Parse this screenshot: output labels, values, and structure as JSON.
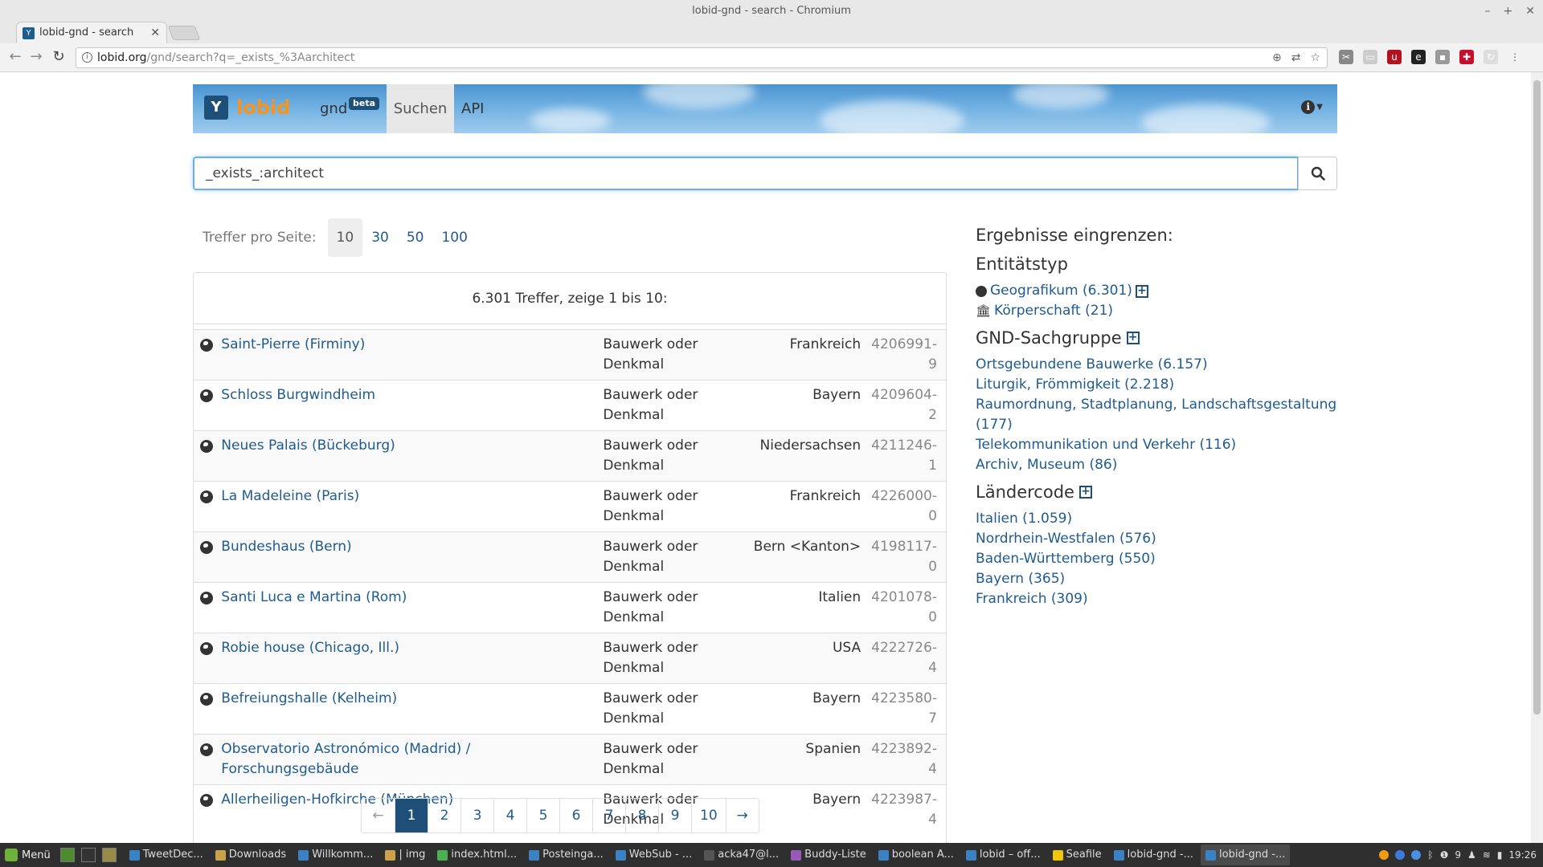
{
  "window": {
    "title": "lobid-gnd - search - Chromium",
    "tab_title": "lobid-gnd - search",
    "url_host": "lobid.org",
    "url_path": "/gnd/search?q=_exists_%3Aarchitect"
  },
  "header": {
    "brand": "lobid",
    "gnd": "gnd",
    "beta": "beta",
    "suchen": "Suchen",
    "api": "API"
  },
  "search": {
    "value": "_exists_:architect"
  },
  "perpage": {
    "label": "Treffer pro Seite:",
    "options": [
      "10",
      "30",
      "50",
      "100"
    ],
    "selected": "10"
  },
  "results": {
    "summary": "6.301 Treffer, zeige 1 bis 10:",
    "rows": [
      {
        "name": "Saint-Pierre (Firminy)",
        "type": "Bauwerk oder Denkmal",
        "country": "Frankreich",
        "id": "4206991-9"
      },
      {
        "name": "Schloss Burgwindheim",
        "type": "Bauwerk oder Denkmal",
        "country": "Bayern",
        "id": "4209604-2"
      },
      {
        "name": "Neues Palais (Bückeburg)",
        "type": "Bauwerk oder Denkmal",
        "country": "Niedersachsen",
        "id": "4211246-1"
      },
      {
        "name": "La Madeleine (Paris)",
        "type": "Bauwerk oder Denkmal",
        "country": "Frankreich",
        "id": "4226000-0"
      },
      {
        "name": "Bundeshaus (Bern)",
        "type": "Bauwerk oder Denkmal",
        "country": "Bern <Kanton>",
        "id": "4198117-0"
      },
      {
        "name": "Santi Luca e Martina (Rom)",
        "type": "Bauwerk oder Denkmal",
        "country": "Italien",
        "id": "4201078-0"
      },
      {
        "name": "Robie house (Chicago, Ill.)",
        "type": "Bauwerk oder Denkmal",
        "country": "USA",
        "id": "4222726-4"
      },
      {
        "name": "Befreiungshalle (Kelheim)",
        "type": "Bauwerk oder Denkmal",
        "country": "Bayern",
        "id": "4223580-7"
      },
      {
        "name": "Observatorio Astronómico (Madrid) / Forschungsgebäude",
        "type": "Bauwerk oder Denkmal",
        "country": "Spanien",
        "id": "4223892-4"
      },
      {
        "name": "Allerheiligen-Hofkirche (München)",
        "type": "Bauwerk oder Denkmal",
        "country": "Bayern",
        "id": "4223987-4"
      }
    ]
  },
  "pagination": {
    "prev": "←",
    "pages": [
      "1",
      "2",
      "3",
      "4",
      "5",
      "6",
      "7",
      "8",
      "9",
      "10"
    ],
    "current": "1",
    "next": "→"
  },
  "facets": {
    "title": "Ergebnisse eingrenzen:",
    "entity_heading": "Entitätstyp",
    "entity_items": [
      "Geografikum (6.301)",
      "Körperschaft (21)"
    ],
    "sachgruppe_heading": "GND-Sachgruppe",
    "sachgruppe_items": [
      "Ortsgebundene Bauwerke (6.157)",
      "Liturgik, Frömmigkeit (2.218)",
      "Raumordnung, Stadtplanung, Landschaftsgestaltung (177)",
      "Telekommunikation und Verkehr (116)",
      "Archiv, Museum (86)"
    ],
    "laendercode_heading": "Ländercode",
    "laendercode_items": [
      "Italien (1.059)",
      "Nordrhein-Westfalen (576)",
      "Baden-Württemberg (550)",
      "Bayern (365)",
      "Frankreich (309)"
    ]
  },
  "taskbar": {
    "menu": "Menü",
    "tasks": [
      "TweetDec...",
      "Downloads",
      "Willkomm...",
      "| img",
      "index.html...",
      "Posteinga...",
      "WebSub - ...",
      "acka47@l...",
      "Buddy-Liste",
      "boolean A...",
      "lobid – off...",
      "Seafile",
      "lobid-gnd -...",
      "lobid-gnd -..."
    ],
    "tray_count": "9",
    "clock": "19:26"
  },
  "colors": {
    "link": "#1f5b8f",
    "brand_dark": "#1d4f78",
    "brand_orange": "#f7941d",
    "focus_border": "#66afe9"
  }
}
